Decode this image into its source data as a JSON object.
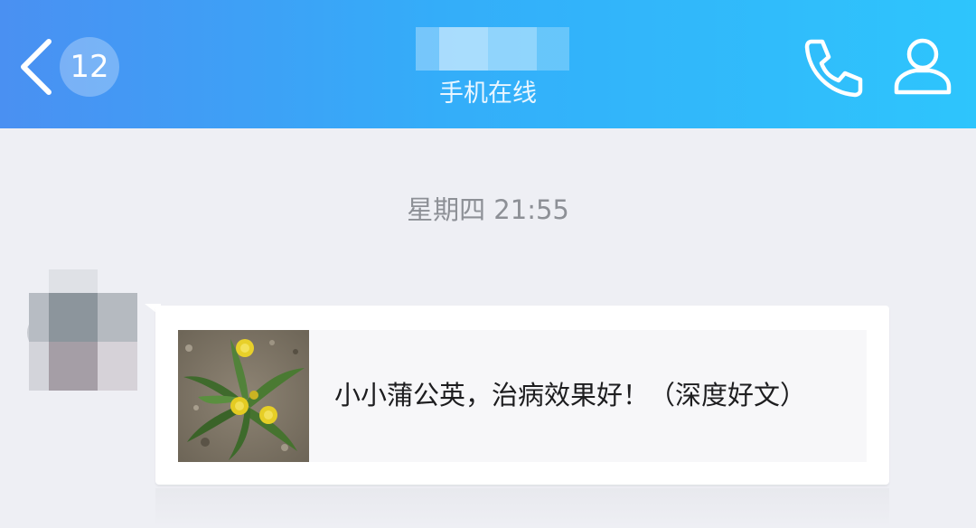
{
  "header": {
    "unread_count": "12",
    "contact_status": "手机在线",
    "back_icon": "chevron-left-icon",
    "call_icon": "phone-icon",
    "profile_icon": "user-icon"
  },
  "chat": {
    "timestamp": "星期四 21:55",
    "messages": [
      {
        "type": "link-card",
        "title": "小小蒲公英，治病效果好！（深度好文）",
        "thumbnail": "dandelion-photo"
      }
    ]
  },
  "colors": {
    "header_gradient_start": "#4a90f2",
    "header_gradient_end": "#2ec5fc",
    "chat_background": "#eeeff4",
    "bubble_background": "#ffffff",
    "card_background": "#f7f7f9",
    "timestamp_text": "#8d9096"
  }
}
